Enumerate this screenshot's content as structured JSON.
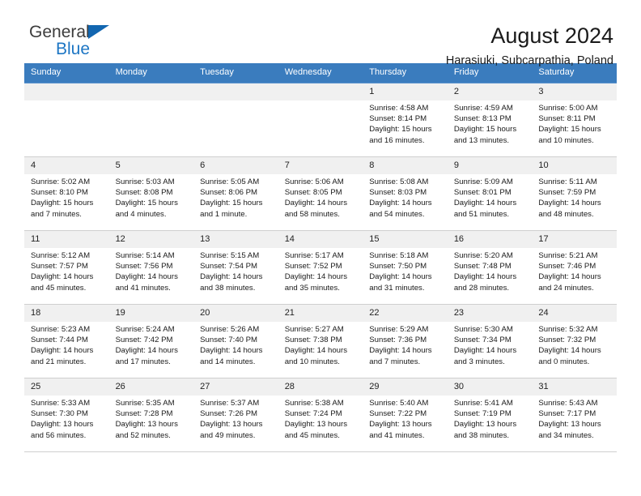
{
  "brand": {
    "name_top": "General",
    "name_bottom": "Blue",
    "triangle_color": "#1266b0",
    "blue_color": "#1d76c4"
  },
  "header": {
    "title": "August 2024",
    "subtitle": "Harasiuki, Subcarpathia, Poland",
    "header_bg": "#3a7cbe"
  },
  "calendar": {
    "weekdays": [
      "Sunday",
      "Monday",
      "Tuesday",
      "Wednesday",
      "Thursday",
      "Friday",
      "Saturday"
    ],
    "weeks": [
      [
        {
          "day": "",
          "empty": true
        },
        {
          "day": "",
          "empty": true
        },
        {
          "day": "",
          "empty": true
        },
        {
          "day": "",
          "empty": true
        },
        {
          "day": "1",
          "sunrise": "Sunrise: 4:58 AM",
          "sunset": "Sunset: 8:14 PM",
          "daylight": "Daylight: 15 hours and 16 minutes."
        },
        {
          "day": "2",
          "sunrise": "Sunrise: 4:59 AM",
          "sunset": "Sunset: 8:13 PM",
          "daylight": "Daylight: 15 hours and 13 minutes."
        },
        {
          "day": "3",
          "sunrise": "Sunrise: 5:00 AM",
          "sunset": "Sunset: 8:11 PM",
          "daylight": "Daylight: 15 hours and 10 minutes."
        }
      ],
      [
        {
          "day": "4",
          "sunrise": "Sunrise: 5:02 AM",
          "sunset": "Sunset: 8:10 PM",
          "daylight": "Daylight: 15 hours and 7 minutes."
        },
        {
          "day": "5",
          "sunrise": "Sunrise: 5:03 AM",
          "sunset": "Sunset: 8:08 PM",
          "daylight": "Daylight: 15 hours and 4 minutes."
        },
        {
          "day": "6",
          "sunrise": "Sunrise: 5:05 AM",
          "sunset": "Sunset: 8:06 PM",
          "daylight": "Daylight: 15 hours and 1 minute."
        },
        {
          "day": "7",
          "sunrise": "Sunrise: 5:06 AM",
          "sunset": "Sunset: 8:05 PM",
          "daylight": "Daylight: 14 hours and 58 minutes."
        },
        {
          "day": "8",
          "sunrise": "Sunrise: 5:08 AM",
          "sunset": "Sunset: 8:03 PM",
          "daylight": "Daylight: 14 hours and 54 minutes."
        },
        {
          "day": "9",
          "sunrise": "Sunrise: 5:09 AM",
          "sunset": "Sunset: 8:01 PM",
          "daylight": "Daylight: 14 hours and 51 minutes."
        },
        {
          "day": "10",
          "sunrise": "Sunrise: 5:11 AM",
          "sunset": "Sunset: 7:59 PM",
          "daylight": "Daylight: 14 hours and 48 minutes."
        }
      ],
      [
        {
          "day": "11",
          "sunrise": "Sunrise: 5:12 AM",
          "sunset": "Sunset: 7:57 PM",
          "daylight": "Daylight: 14 hours and 45 minutes."
        },
        {
          "day": "12",
          "sunrise": "Sunrise: 5:14 AM",
          "sunset": "Sunset: 7:56 PM",
          "daylight": "Daylight: 14 hours and 41 minutes."
        },
        {
          "day": "13",
          "sunrise": "Sunrise: 5:15 AM",
          "sunset": "Sunset: 7:54 PM",
          "daylight": "Daylight: 14 hours and 38 minutes."
        },
        {
          "day": "14",
          "sunrise": "Sunrise: 5:17 AM",
          "sunset": "Sunset: 7:52 PM",
          "daylight": "Daylight: 14 hours and 35 minutes."
        },
        {
          "day": "15",
          "sunrise": "Sunrise: 5:18 AM",
          "sunset": "Sunset: 7:50 PM",
          "daylight": "Daylight: 14 hours and 31 minutes."
        },
        {
          "day": "16",
          "sunrise": "Sunrise: 5:20 AM",
          "sunset": "Sunset: 7:48 PM",
          "daylight": "Daylight: 14 hours and 28 minutes."
        },
        {
          "day": "17",
          "sunrise": "Sunrise: 5:21 AM",
          "sunset": "Sunset: 7:46 PM",
          "daylight": "Daylight: 14 hours and 24 minutes."
        }
      ],
      [
        {
          "day": "18",
          "sunrise": "Sunrise: 5:23 AM",
          "sunset": "Sunset: 7:44 PM",
          "daylight": "Daylight: 14 hours and 21 minutes."
        },
        {
          "day": "19",
          "sunrise": "Sunrise: 5:24 AM",
          "sunset": "Sunset: 7:42 PM",
          "daylight": "Daylight: 14 hours and 17 minutes."
        },
        {
          "day": "20",
          "sunrise": "Sunrise: 5:26 AM",
          "sunset": "Sunset: 7:40 PM",
          "daylight": "Daylight: 14 hours and 14 minutes."
        },
        {
          "day": "21",
          "sunrise": "Sunrise: 5:27 AM",
          "sunset": "Sunset: 7:38 PM",
          "daylight": "Daylight: 14 hours and 10 minutes."
        },
        {
          "day": "22",
          "sunrise": "Sunrise: 5:29 AM",
          "sunset": "Sunset: 7:36 PM",
          "daylight": "Daylight: 14 hours and 7 minutes."
        },
        {
          "day": "23",
          "sunrise": "Sunrise: 5:30 AM",
          "sunset": "Sunset: 7:34 PM",
          "daylight": "Daylight: 14 hours and 3 minutes."
        },
        {
          "day": "24",
          "sunrise": "Sunrise: 5:32 AM",
          "sunset": "Sunset: 7:32 PM",
          "daylight": "Daylight: 14 hours and 0 minutes."
        }
      ],
      [
        {
          "day": "25",
          "sunrise": "Sunrise: 5:33 AM",
          "sunset": "Sunset: 7:30 PM",
          "daylight": "Daylight: 13 hours and 56 minutes."
        },
        {
          "day": "26",
          "sunrise": "Sunrise: 5:35 AM",
          "sunset": "Sunset: 7:28 PM",
          "daylight": "Daylight: 13 hours and 52 minutes."
        },
        {
          "day": "27",
          "sunrise": "Sunrise: 5:37 AM",
          "sunset": "Sunset: 7:26 PM",
          "daylight": "Daylight: 13 hours and 49 minutes."
        },
        {
          "day": "28",
          "sunrise": "Sunrise: 5:38 AM",
          "sunset": "Sunset: 7:24 PM",
          "daylight": "Daylight: 13 hours and 45 minutes."
        },
        {
          "day": "29",
          "sunrise": "Sunrise: 5:40 AM",
          "sunset": "Sunset: 7:22 PM",
          "daylight": "Daylight: 13 hours and 41 minutes."
        },
        {
          "day": "30",
          "sunrise": "Sunrise: 5:41 AM",
          "sunset": "Sunset: 7:19 PM",
          "daylight": "Daylight: 13 hours and 38 minutes."
        },
        {
          "day": "31",
          "sunrise": "Sunrise: 5:43 AM",
          "sunset": "Sunset: 7:17 PM",
          "daylight": "Daylight: 13 hours and 34 minutes."
        }
      ]
    ]
  }
}
